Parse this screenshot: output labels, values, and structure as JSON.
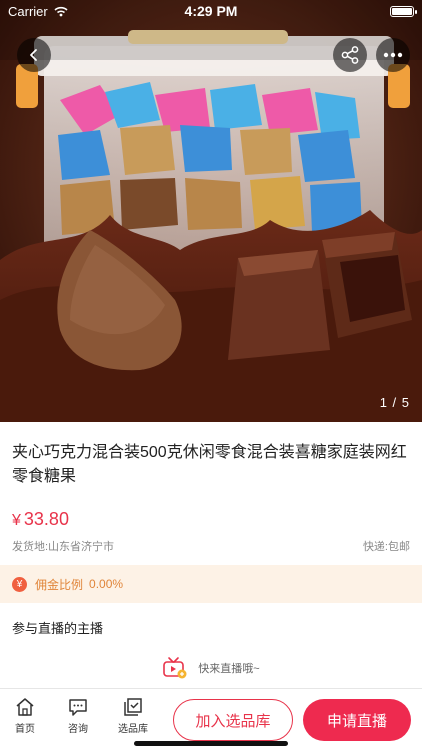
{
  "status_bar": {
    "carrier": "Carrier",
    "time": "4:29 PM"
  },
  "gallery": {
    "counter": "1 / 5"
  },
  "product": {
    "title": "夹心巧克力混合装500克休闲零食混合装喜糖家庭装网红零食糖果",
    "price_symbol": "¥",
    "price": "33.80",
    "origin": "发货地:山东省济宁市",
    "shipping": "快递:包邮"
  },
  "commission": {
    "icon_text": "¥",
    "label": "佣金比例",
    "value": "0.00%"
  },
  "hosts": {
    "title": "参与直播的主播",
    "empty_text": "快来直播哦~"
  },
  "bottom_bar": {
    "tabs": [
      {
        "label": "首页"
      },
      {
        "label": "咨询"
      },
      {
        "label": "选品库"
      }
    ],
    "add_button": "加入选品库",
    "apply_button": "申请直播"
  },
  "colors": {
    "accent": "#e8334a",
    "commission_bg": "#fdf2e6",
    "commission_text": "#e0853a"
  }
}
